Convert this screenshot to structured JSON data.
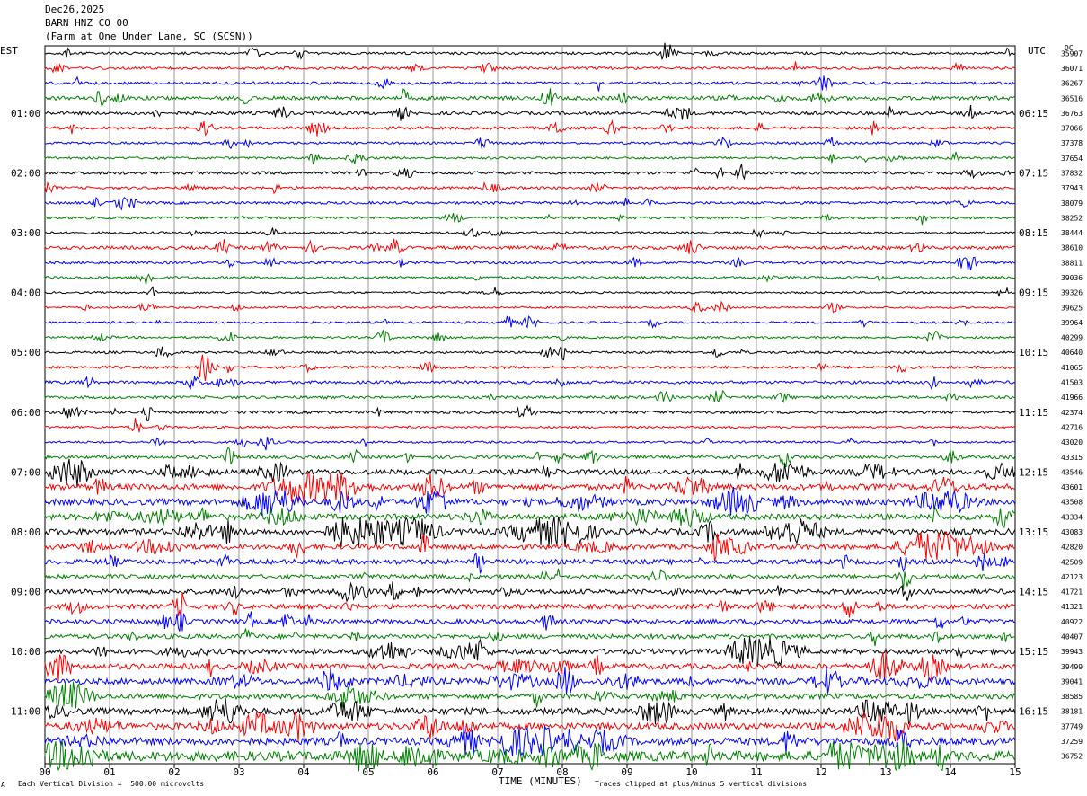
{
  "header": {
    "date": "Dec26,2025",
    "station": "BARN HNZ CO 00",
    "location": "(Farm at One Under Lane, SC (SCSN))"
  },
  "left_tz": "EST",
  "right_tz": "UTC",
  "right_col_header": "DC",
  "footer": {
    "left_mark": "A",
    "scale_note": "Each Vertical Division =  500.00 microvolts",
    "xlabel": "TIME (MINUTES)",
    "clip_note": "Traces clipped at plus/minus 5 vertical divisions"
  },
  "chart_data": {
    "type": "line",
    "title": "",
    "xlabel": "TIME (MINUTES)",
    "ylabel": "",
    "xlim": [
      0,
      15
    ],
    "x_ticks": [
      "00",
      "01",
      "02",
      "03",
      "04",
      "05",
      "06",
      "07",
      "08",
      "09",
      "10",
      "11",
      "12",
      "13",
      "14",
      "15"
    ],
    "grid": true,
    "trace_colors": [
      "#000000",
      "#ff0000",
      "#0000ff",
      "#008000"
    ],
    "left_labels": [
      "01:00",
      "02:00",
      "03:00",
      "04:00",
      "05:00",
      "06:00",
      "07:00",
      "08:00",
      "09:00",
      "10:00",
      "11:00"
    ],
    "right_labels": [
      "06:15",
      "07:15",
      "08:15",
      "09:15",
      "10:15",
      "11:15",
      "12:15",
      "13:15",
      "14:15",
      "15:15",
      "16:15"
    ],
    "dc_offsets": [
      "35907",
      "36071",
      "36267",
      "36516",
      "36763",
      "37066",
      "37378",
      "37654",
      "37832",
      "37943",
      "38079",
      "38252",
      "38444",
      "38610",
      "38811",
      "39036",
      "39326",
      "39625",
      "39964",
      "40299",
      "40640",
      "41065",
      "41503",
      "41966",
      "42374",
      "42716",
      "43020",
      "43315",
      "43546",
      "43601",
      "43508",
      "43334",
      "43083",
      "42820",
      "42509",
      "42123",
      "41721",
      "41321",
      "40922",
      "40407",
      "39943",
      "39499",
      "39041",
      "38585",
      "38181",
      "37749",
      "37259",
      "36752"
    ],
    "activity_level": [
      1.5,
      1.6,
      1.7,
      2.4,
      2.0,
      1.8,
      1.4,
      1.4,
      1.8,
      1.6,
      1.6,
      1.6,
      1.3,
      2.0,
      1.6,
      1.6,
      1.2,
      1.2,
      1.3,
      1.3,
      1.4,
      1.7,
      1.8,
      1.7,
      1.8,
      1.3,
      1.3,
      2.0,
      3.2,
      3.6,
      3.8,
      3.6,
      3.8,
      3.2,
      3.0,
      2.6,
      3.0,
      3.0,
      2.8,
      2.8,
      3.2,
      3.4,
      3.6,
      3.2,
      4.0,
      4.0,
      4.5,
      6.0
    ]
  }
}
